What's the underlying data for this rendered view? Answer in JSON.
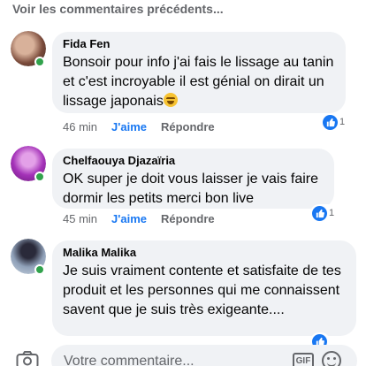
{
  "header": {
    "previous_comments_link": "Voir les commentaires précédents..."
  },
  "comments": [
    {
      "author": "Fida Fen",
      "text": "Bonsoir pour info j'ai fais le lissage au tanin et c'est incroyable il est génial on dirait un lissage japonais",
      "emoji": "star-struck-emoji",
      "time": "46 min",
      "like_label": "J'aime",
      "reply_label": "Répondre",
      "reaction_count": "1",
      "online": true
    },
    {
      "author": "Chelfaouya Djazaïria",
      "text": "OK super je doit vous  laisser je vais faire dormir les petits  merci bon live",
      "time": "45 min",
      "like_label": "J'aime",
      "reply_label": "Répondre",
      "reaction_count": "1",
      "online": true
    },
    {
      "author": "Malika Malika",
      "text": "Je suis vraiment contente et satisfaite de tes produit et les personnes qui me connaissent savent que je suis très exigeante....",
      "reaction_count": "",
      "online": true
    }
  ],
  "composer": {
    "placeholder": "Votre commentaire...",
    "gif_label": "GIF",
    "camera_icon": "camera-icon",
    "emoji_icon": "emoji-icon"
  },
  "colors": {
    "like": "#1877f2",
    "secondary_text": "#65676b",
    "bubble": "#f0f2f5",
    "online": "#31a24c"
  }
}
